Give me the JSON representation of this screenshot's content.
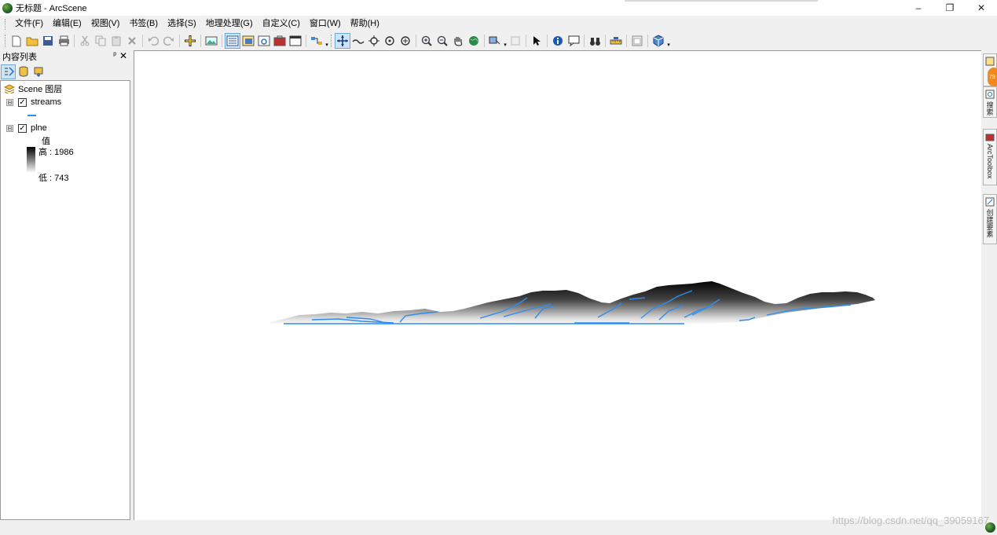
{
  "window": {
    "title": "无标题 - ArcScene",
    "minimize": "–",
    "restore": "❐",
    "close": "✕"
  },
  "menu": [
    "文件(F)",
    "编辑(E)",
    "视图(V)",
    "书签(B)",
    "选择(S)",
    "地理处理(G)",
    "自定义(C)",
    "窗口(W)",
    "帮助(H)"
  ],
  "panel": {
    "title": "内容列表",
    "pin": "ᵖ",
    "close": "✕",
    "root": "Scene 图层",
    "layers": [
      {
        "name": "streams",
        "checked": true,
        "expander": "⊟"
      },
      {
        "name": "plne",
        "checked": true,
        "expander": "⊟",
        "legend_title": "值",
        "high": "高 : 1986",
        "low": "低 : 743"
      }
    ]
  },
  "right_dock": {
    "badge": "79",
    "tabs": [
      "搜索",
      "ArcToolbox",
      "创建要素"
    ]
  },
  "watermark": "https://blog.csdn.net/qq_39059167",
  "colors": {
    "stream": "#2b8ef0",
    "terrain_high": "#000000",
    "terrain_low": "#ffffff",
    "active_tool": "#cde4f7"
  }
}
